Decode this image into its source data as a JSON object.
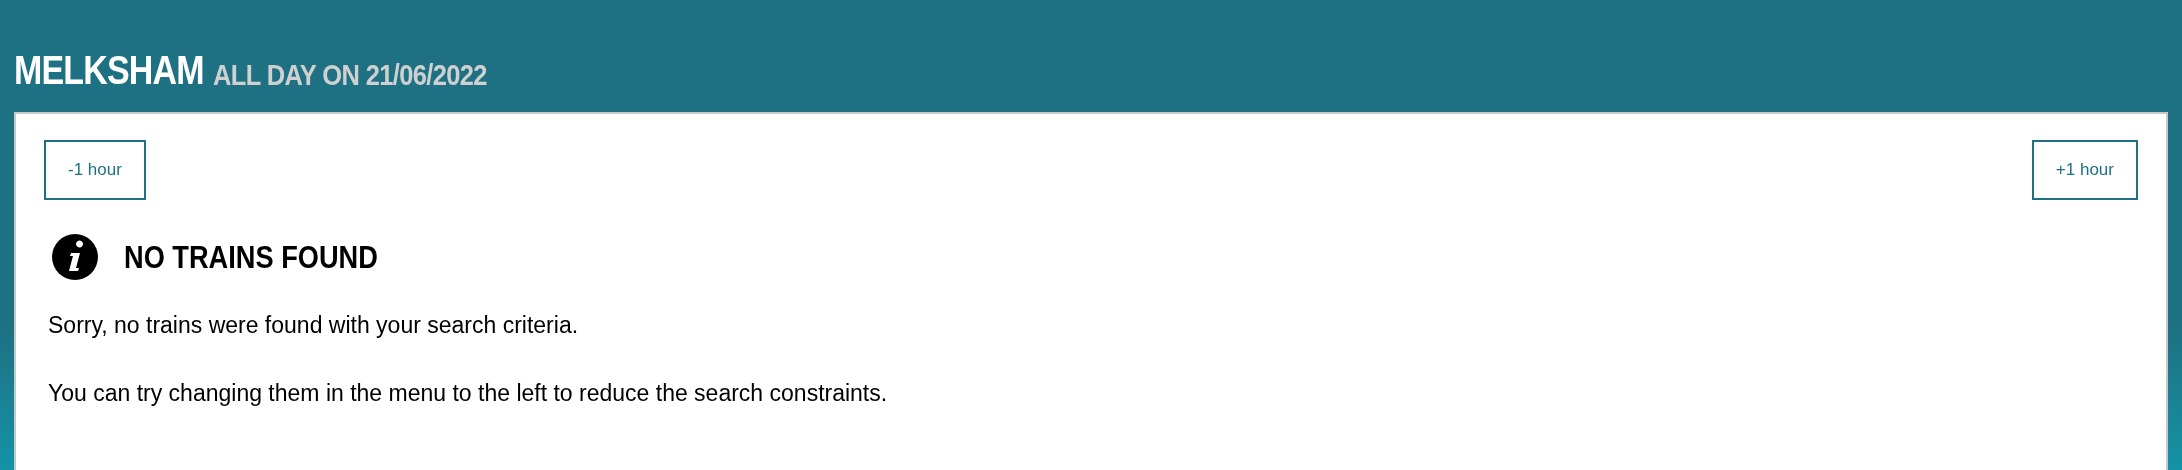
{
  "header": {
    "station": "MELKSHAM",
    "period": "ALL DAY ON 21/06/2022"
  },
  "buttons": [
    {
      "label": "-1 hour"
    },
    {
      "label": "+1 hour"
    }
  ],
  "notice": {
    "title": "NO TRAINS FOUND",
    "paragraphs": [
      "Sorry, no trains were found with your search criteria.",
      "You can try changing them in the menu to the left to reduce the search constraints."
    ]
  }
}
